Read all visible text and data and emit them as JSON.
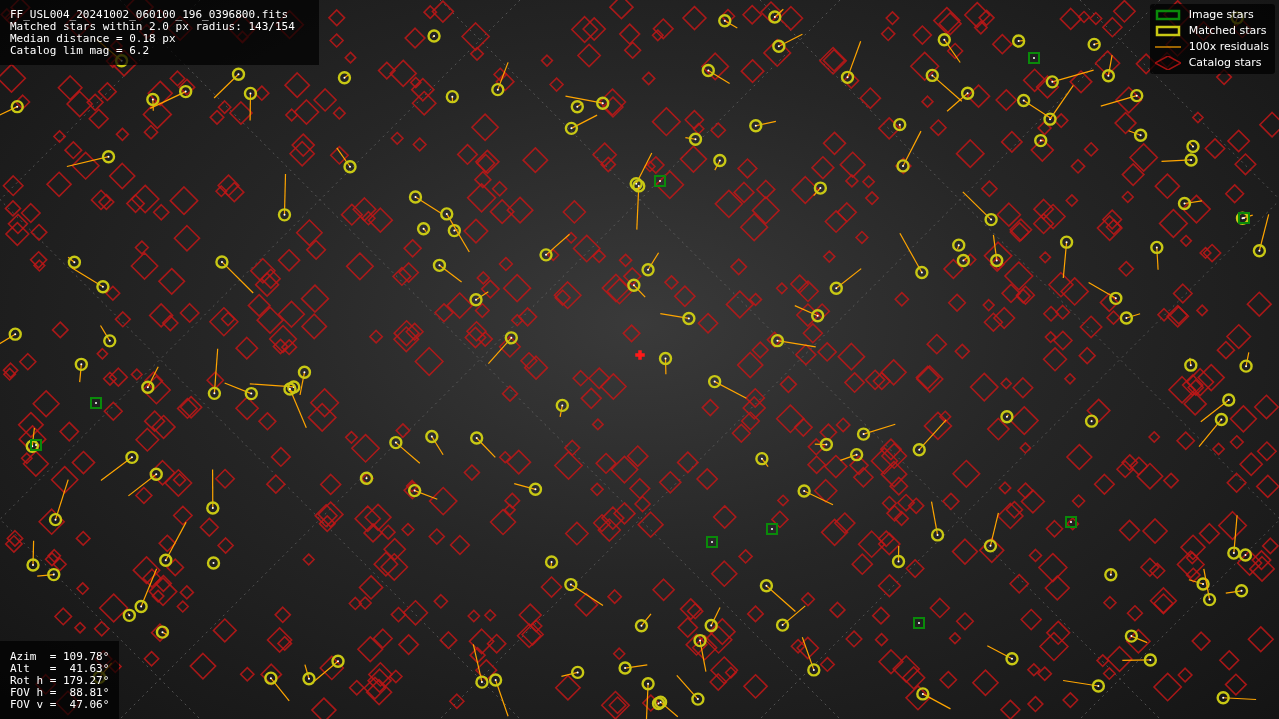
{
  "info": {
    "lines": [
      "FF_USL004_20241002_060100_196_0396800.fits",
      "Matched stars within 2.0 px radius: 143/154",
      "Median distance = 0.18 px",
      "Catalog lim mag = 6.2"
    ]
  },
  "legend": [
    {
      "kind": "image",
      "label": "Image stars"
    },
    {
      "kind": "matched",
      "label": "Matched stars"
    },
    {
      "kind": "residual",
      "label": "100x residuals"
    },
    {
      "kind": "catalog",
      "label": "Catalog stars"
    }
  ],
  "pointing": {
    "lines": [
      "Azim  = 109.78°",
      "Alt   =  41.63°",
      "Rot h = 179.27°",
      "FOV h =  88.81°",
      "FOV v =  47.06°"
    ]
  }
}
